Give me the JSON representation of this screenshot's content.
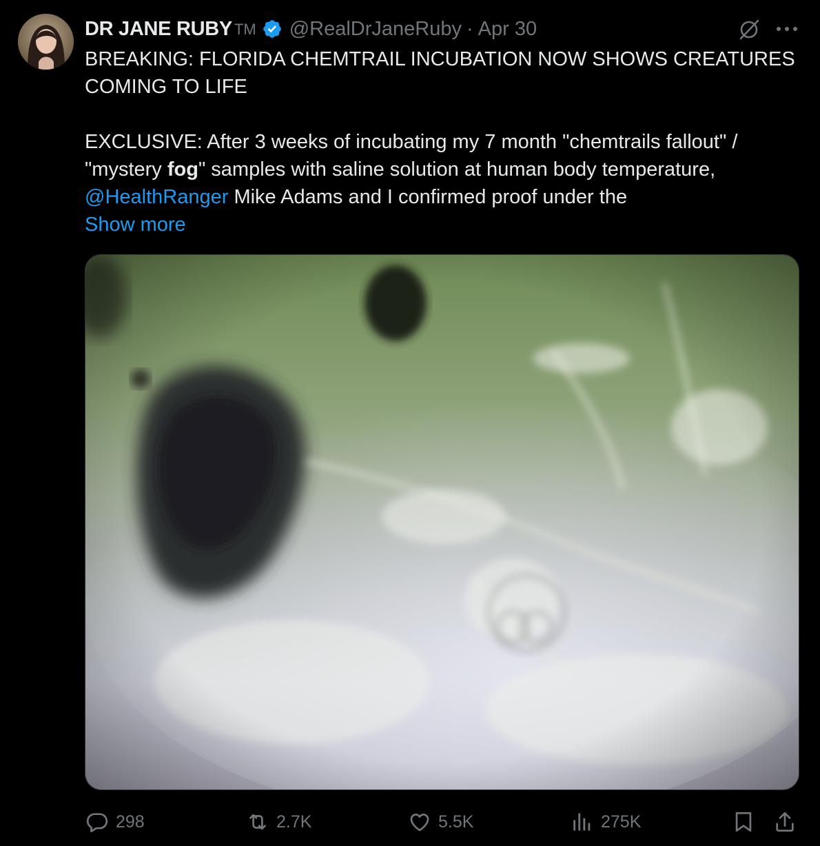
{
  "author": {
    "name": "DR JANE RUBY",
    "badge_text": "TM",
    "handle": "@RealDrJaneRuby",
    "separator": "·",
    "date": "Apr 30"
  },
  "tweet": {
    "line1": "BREAKING: FLORIDA CHEMTRAIL INCUBATION NOW SHOWS CREATURES",
    "line2": "COMING TO LIFE",
    "line3": "EXCLUSIVE: After 3 weeks of incubating my 7 month  \"chemtrails fallout\" /",
    "line4_a": "\"mystery ",
    "line4_bold": "fog",
    "line4_b": "\" samples with saline solution at human body temperature,",
    "mention": "@HealthRanger",
    "line5_rest": " Mike Adams and I confirmed proof under the",
    "show_more": "Show more"
  },
  "stats": {
    "replies": "298",
    "reposts": "2.7K",
    "likes": "5.5K",
    "views": "275K"
  },
  "icons": {
    "reply": "reply-icon",
    "repost": "repost-icon",
    "like": "heart-icon",
    "views": "views-icon",
    "bookmark": "bookmark-icon",
    "share": "share-icon",
    "grok": "grok-icon",
    "more": "more-icon",
    "verified": "verified-badge-icon"
  },
  "colors": {
    "background": "#000000",
    "text": "#e7e9ea",
    "muted": "#71767b",
    "link": "#1d9bf0",
    "verified": "#1d9bf0"
  }
}
